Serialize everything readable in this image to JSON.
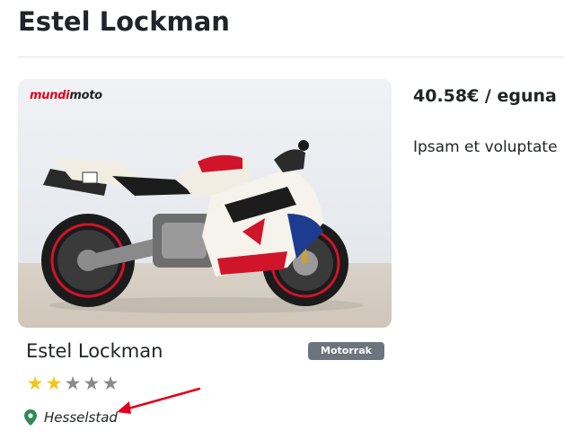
{
  "header": {
    "title": "Estel Lockman"
  },
  "listing": {
    "image": {
      "logo_part1": "mundi",
      "logo_part2": "moto"
    },
    "price": "40.58€ / eguna",
    "description": "Ipsam et voluptate",
    "title": "Estel Lockman",
    "category_badge": "Motorrak",
    "rating": {
      "value": 2,
      "max": 5
    },
    "location": "Hesselstad"
  },
  "colors": {
    "star_filled": "#f5c518",
    "star_empty": "#8a8a8a",
    "badge_bg": "#6c757d",
    "location_pin": "#2e8b57",
    "annotation_arrow": "#e2001a",
    "logo_red": "#e2001a"
  },
  "icons": {
    "location": "map-pin-icon",
    "star": "star-icon",
    "annotation": "arrow-icon"
  }
}
